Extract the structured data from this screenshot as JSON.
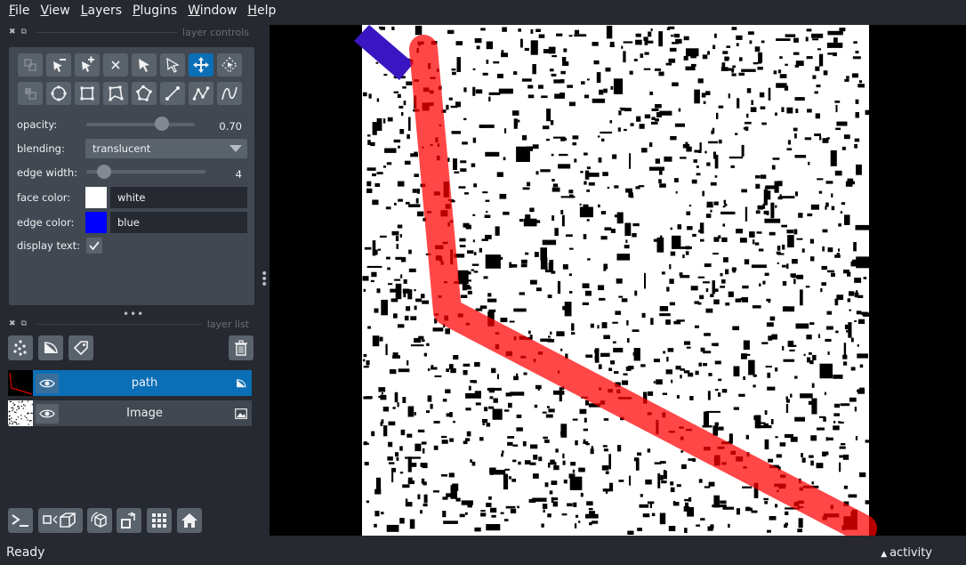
{
  "menu": [
    "File",
    "View",
    "Layers",
    "Plugins",
    "Window",
    "Help"
  ],
  "layer_controls": {
    "title": "layer controls",
    "opacity_label": "opacity:",
    "opacity_value": "0.70",
    "opacity_fraction": 0.7,
    "blending_label": "blending:",
    "blending_value": "translucent",
    "edge_width_label": "edge width:",
    "edge_width_value": "4",
    "face_color_label": "face color:",
    "face_color_value": "white",
    "face_color_hex": "#ffffff",
    "edge_color_label": "edge color:",
    "edge_color_value": "blue",
    "edge_color_hex": "#0000ff",
    "display_text_label": "display text:",
    "display_text_checked": true
  },
  "layer_list": {
    "title": "layer list",
    "layers": [
      {
        "name": "path",
        "selected": true,
        "visible": true,
        "type_icon": "shapes-icon"
      },
      {
        "name": "Image",
        "selected": false,
        "visible": true,
        "type_icon": "image-icon"
      }
    ]
  },
  "status": {
    "text": "Ready",
    "activity": "activity"
  },
  "colors": {
    "accent": "#0b6fb7",
    "path_color": "#ff0000"
  }
}
